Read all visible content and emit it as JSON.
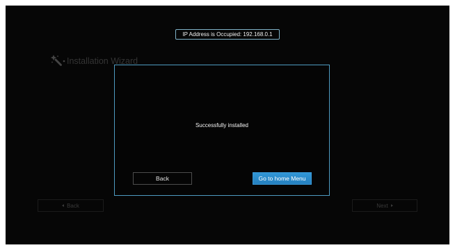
{
  "banner": {
    "text": "IP Address is Occupied: 192.168.0.1"
  },
  "wizard": {
    "title": "Installation Wizard",
    "icon": "magic-wand-icon"
  },
  "dialog": {
    "message": "Successfully installed",
    "back_label": "Back",
    "home_label": "Go to home Menu"
  },
  "footer": {
    "back_label": "Back",
    "back_icon": "arrow-left-icon",
    "next_label": "Next",
    "next_icon": "arrow-right-icon"
  },
  "colors": {
    "background": "#060606",
    "dialog_border": "#4e9cc2",
    "banner_border": "#7fb2c8",
    "primary_button": "#2b8ccc",
    "dimmed_text": "#343434"
  }
}
